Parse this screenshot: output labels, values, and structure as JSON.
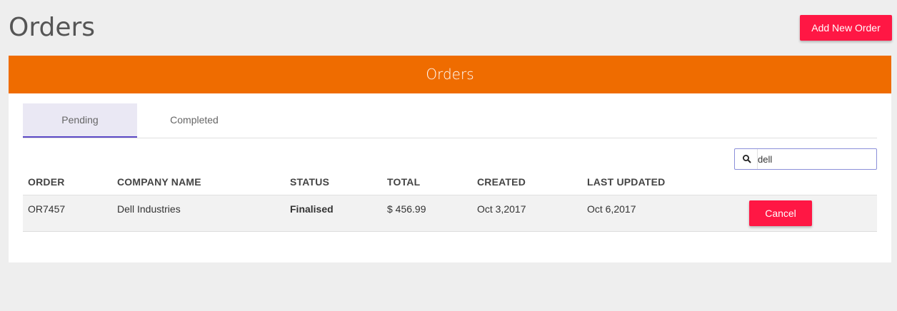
{
  "page": {
    "title": "Orders",
    "add_button_label": "Add New Order"
  },
  "panel": {
    "header_title": "Orders",
    "tabs": [
      {
        "label": "Pending",
        "active": true
      },
      {
        "label": "Completed",
        "active": false
      }
    ]
  },
  "search": {
    "value": "dell",
    "icon": "search-icon"
  },
  "table": {
    "columns": [
      "ORDER",
      "COMPANY NAME",
      "STATUS",
      "TOTAL",
      "CREATED",
      "LAST UPDATED"
    ],
    "rows": [
      {
        "order": "OR7457",
        "company": "Dell Industries",
        "status": "Finalised",
        "total": "$ 456.99",
        "created": "Oct 3,2017",
        "last_updated": "Oct 6,2017",
        "action_label": "Cancel"
      }
    ]
  },
  "colors": {
    "accent_red": "#ff1744",
    "header_orange": "#ef6c00",
    "tab_active_indicator": "#5c49c6",
    "background": "#eeeeee"
  }
}
